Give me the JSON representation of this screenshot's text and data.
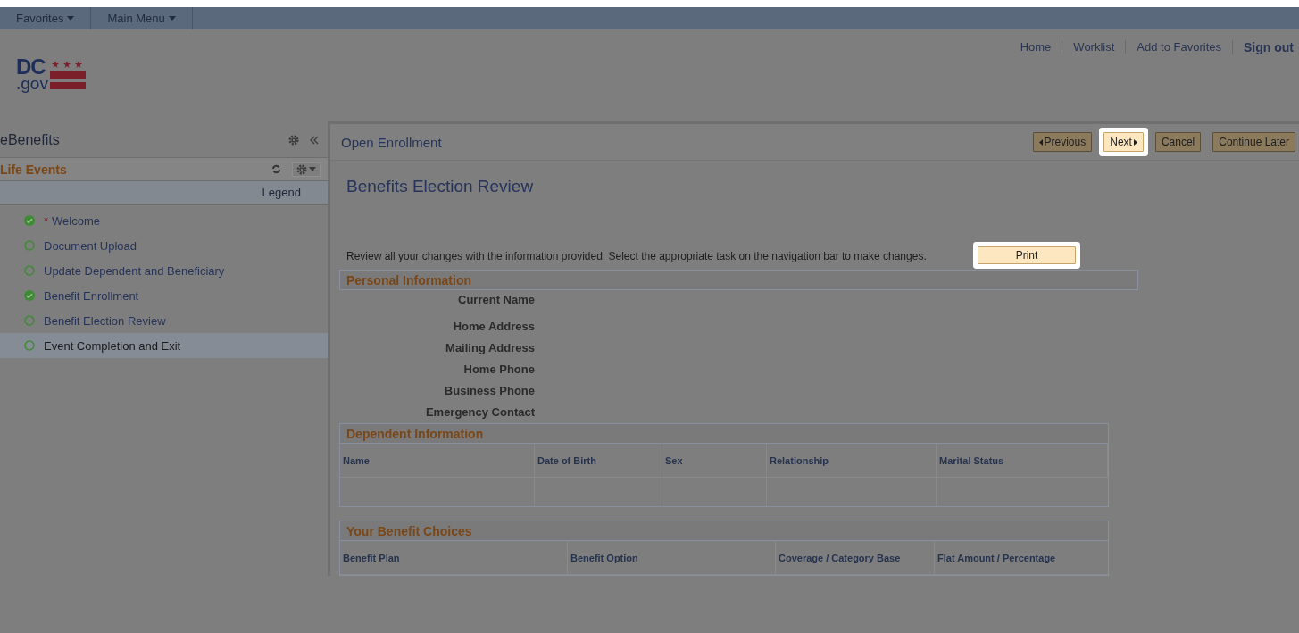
{
  "top_nav": [
    {
      "label": "Favorites"
    },
    {
      "label": "Main Menu"
    }
  ],
  "header_links": [
    {
      "label": "Home",
      "bold": false
    },
    {
      "label": "Worklist",
      "bold": false
    },
    {
      "label": "Add to Favorites",
      "bold": false
    },
    {
      "label": "Sign out",
      "bold": true
    }
  ],
  "logo": {
    "text": "DC",
    "subtext": ".gov"
  },
  "sidebar": {
    "title": "eBenefits",
    "section": "Life Events",
    "legend": "Legend",
    "steps": [
      {
        "label": "Welcome",
        "required": "*",
        "complete": true,
        "selected": false
      },
      {
        "label": "Document Upload",
        "complete": false,
        "selected": false
      },
      {
        "label": "Update Dependent and Beneficiary",
        "complete": false,
        "selected": false
      },
      {
        "label": "Benefit Enrollment",
        "complete": true,
        "selected": false
      },
      {
        "label": "Benefit Election Review",
        "complete": false,
        "selected": false
      },
      {
        "label": "Event Completion and Exit",
        "complete": false,
        "selected": true
      }
    ]
  },
  "main": {
    "title": "Open Enrollment",
    "buttons": [
      {
        "label": "Previous",
        "kind": "prev",
        "highlighted": false
      },
      {
        "label": "Next",
        "kind": "next",
        "highlighted": true
      },
      {
        "label": "Cancel",
        "kind": "plain",
        "highlighted": false
      },
      {
        "label": "Continue Later",
        "kind": "plain",
        "highlighted": false
      }
    ],
    "page_title": "Benefits Election Review",
    "instructions": "Review all your changes with the information provided. Select the appropriate task on the navigation bar to make changes.",
    "print_button": {
      "label": "Print",
      "highlighted": true
    },
    "personal_information": {
      "title": "Personal Information",
      "fields": [
        "Current Name",
        "Home Address",
        "Mailing Address",
        "Home Phone",
        "Business Phone",
        "Emergency Contact"
      ]
    },
    "dependent_information": {
      "title": "Dependent Information",
      "columns": [
        "Name",
        "Date of Birth",
        "Sex",
        "Relationship",
        "Marital Status"
      ]
    },
    "benefit_choices": {
      "title": "Your Benefit Choices",
      "columns": [
        "Benefit Plan",
        "Benefit Option",
        "Coverage / Category Base",
        "Flat Amount / Percentage"
      ]
    }
  }
}
